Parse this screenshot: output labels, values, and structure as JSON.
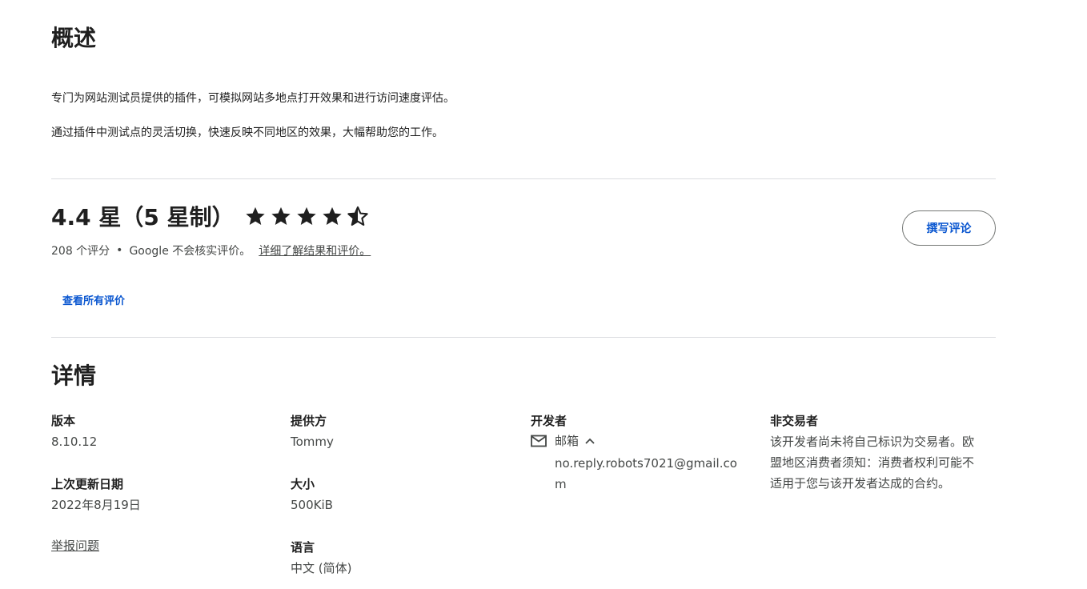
{
  "overview": {
    "title": "概述",
    "paragraphs": [
      "专门为网站测试员提供的插件，可模拟网站多地点打开效果和进行访问速度评估。",
      "通过插件中测试点的灵活切换，快速反映不同地区的效果，大幅帮助您的工作。"
    ]
  },
  "rating": {
    "title": "4.4 星（5 星制）",
    "value": 4.4,
    "max": 5,
    "count_text": "208 个评分",
    "separator": "•",
    "disclaimer": "Google 不会核实评价。",
    "learn_more_link": "详细了解结果和评价。",
    "write_review_button": "撰写评论",
    "view_all_link": "查看所有评价",
    "star_icons": [
      "star-full-icon",
      "star-full-icon",
      "star-full-icon",
      "star-full-icon",
      "star-half-icon"
    ]
  },
  "details": {
    "title": "详情",
    "version_label": "版本",
    "version_value": "8.10.12",
    "updated_label": "上次更新日期",
    "updated_value": "2022年8月19日",
    "report_link": "举报问题",
    "offered_by_label": "提供方",
    "offered_by_value": "Tommy",
    "size_label": "大小",
    "size_value": "500KiB",
    "language_label": "语言",
    "language_value": "中文 (简体)",
    "developer_label": "开发者",
    "email_label": "邮箱",
    "email_value": "no.reply.robots7021@gmail.com",
    "trader_label": "非交易者",
    "trader_value": "该开发者尚未将自己标识为交易者。欧盟地区消费者须知：消费者权利可能不适用于您与该开发者达成的合约。"
  },
  "colors": {
    "accent": "#0b57d0",
    "text": "#1f1f1f",
    "secondary_text": "#444746",
    "divider": "#dadce0"
  }
}
